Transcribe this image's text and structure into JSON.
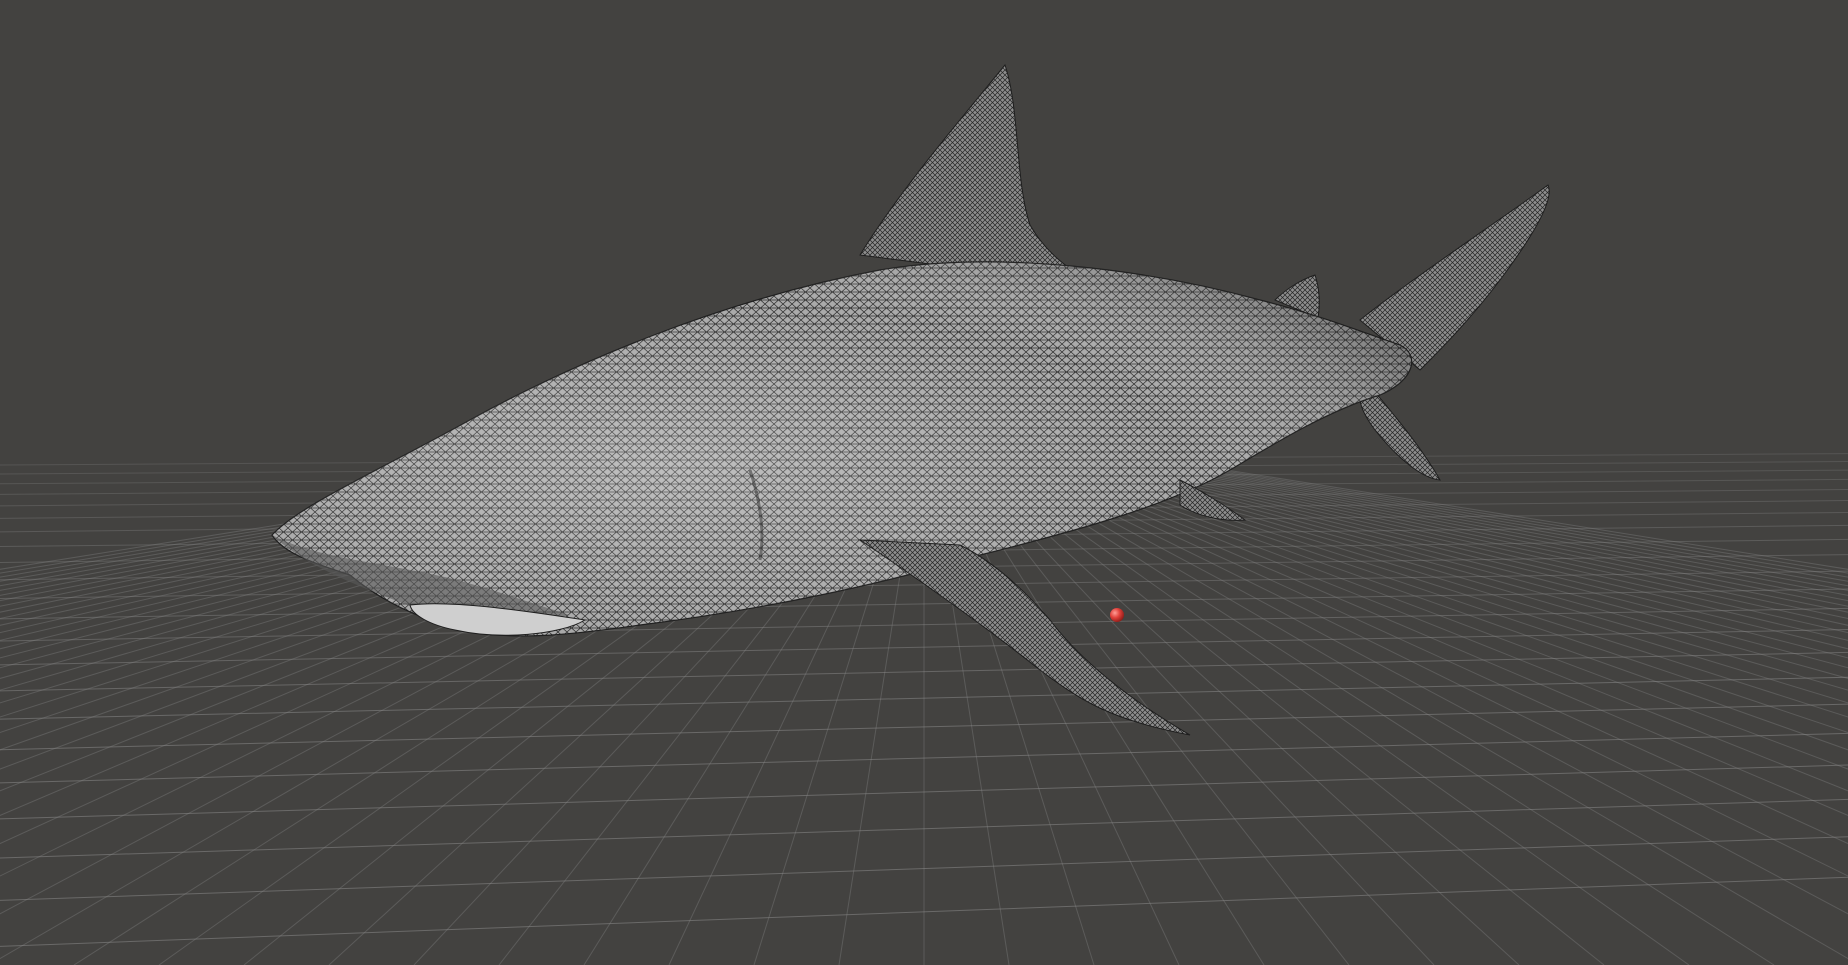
{
  "viewport": {
    "background_color": "#434240",
    "grid_color": "#8a8a8a",
    "model": {
      "name": "",
      "display_mode": "wireframe-on-shaded",
      "surface_color": "#b9b9b9",
      "wire_color": "#2a2a2a"
    },
    "pivot_marker": {
      "icon": "red-sphere-icon",
      "color": "#e0403a"
    }
  }
}
